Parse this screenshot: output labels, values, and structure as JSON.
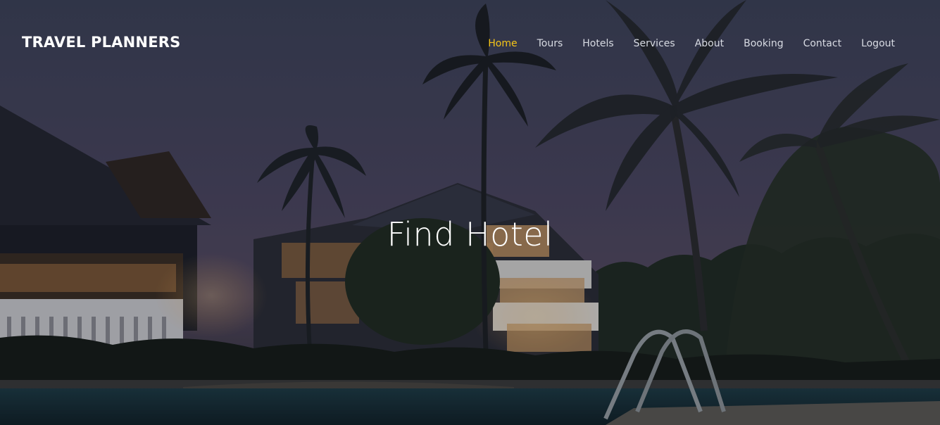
{
  "brand": {
    "name": "TRAVEL PLANNERS"
  },
  "nav": {
    "items": [
      {
        "label": "Home",
        "active": true
      },
      {
        "label": "Tours",
        "active": false
      },
      {
        "label": "Hotels",
        "active": false
      },
      {
        "label": "Services",
        "active": false
      },
      {
        "label": "About",
        "active": false
      },
      {
        "label": "Booking",
        "active": false
      },
      {
        "label": "Contact",
        "active": false
      },
      {
        "label": "Logout",
        "active": false
      }
    ]
  },
  "hero": {
    "headline": "Find Hotel"
  },
  "colors": {
    "nav_active": "#f5c518",
    "nav_default": "#d8dbe3",
    "text_primary": "#ffffff",
    "sky_top": "#3a3f57",
    "sky_bottom": "#5a4a63"
  }
}
